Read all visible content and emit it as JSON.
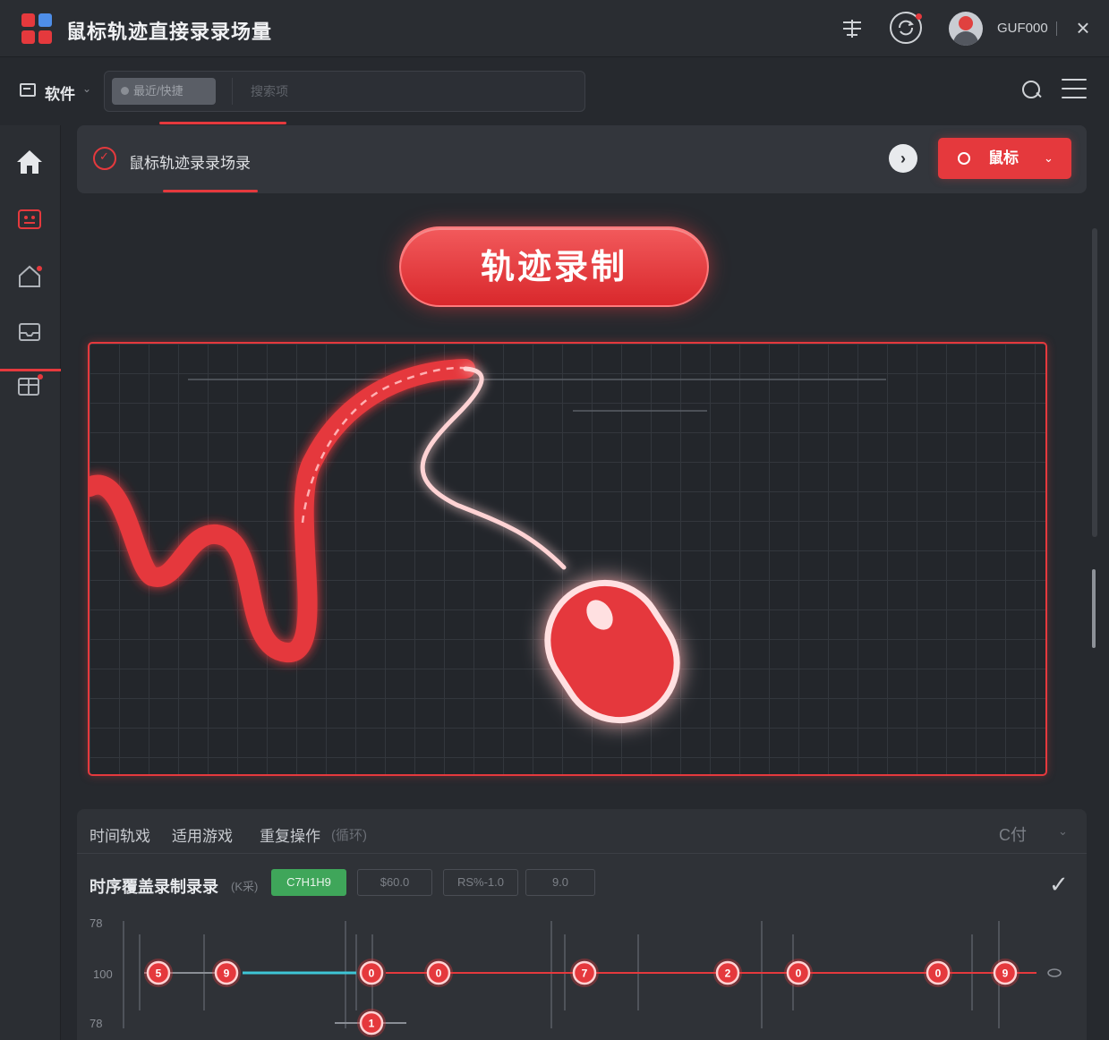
{
  "window": {
    "title": "鼠标轨迹直接录录场量",
    "username": "GUF000"
  },
  "toolbar": {
    "software_label": "软件",
    "pill_label": "最近/快捷",
    "field_placeholder": "搜索项"
  },
  "header": {
    "title": "鼠标轨迹录录场录",
    "mode_button_label": "鼠标"
  },
  "record_button": {
    "label": "轨迹录制"
  },
  "bottom_panel": {
    "tabs": [
      "时间轨戏",
      "适用游戏",
      "重复操作"
    ],
    "tab_extra": "(循环)",
    "right_label": "C付",
    "row_title": "时序覆盖录制录录",
    "row_subtitle": "(K采)",
    "chips": [
      "C7H1H9",
      "$60.0",
      "RS%-1.0",
      "9.0"
    ],
    "axis_labels": [
      "78",
      "100",
      "78"
    ]
  },
  "timeline_nodes": [
    {
      "label": "5"
    },
    {
      "label": "9"
    },
    {
      "label": "0"
    },
    {
      "label": "1"
    },
    {
      "label": "0"
    },
    {
      "label": "7"
    },
    {
      "label": "2"
    },
    {
      "label": "0"
    },
    {
      "label": "0"
    },
    {
      "label": "9"
    }
  ],
  "colors": {
    "accent": "#e5393d",
    "background": "#26292e",
    "panel": "#33363c",
    "chip_green": "#3fa65a",
    "timeline_cyan": "#3ec5d6"
  },
  "icons": {
    "sidebar": [
      "home-icon",
      "dashboard-icon",
      "house-outline-icon",
      "inbox-icon",
      "grid-table-icon"
    ],
    "titlebar": [
      "filter-icon",
      "sync-icon",
      "close-icon"
    ]
  }
}
